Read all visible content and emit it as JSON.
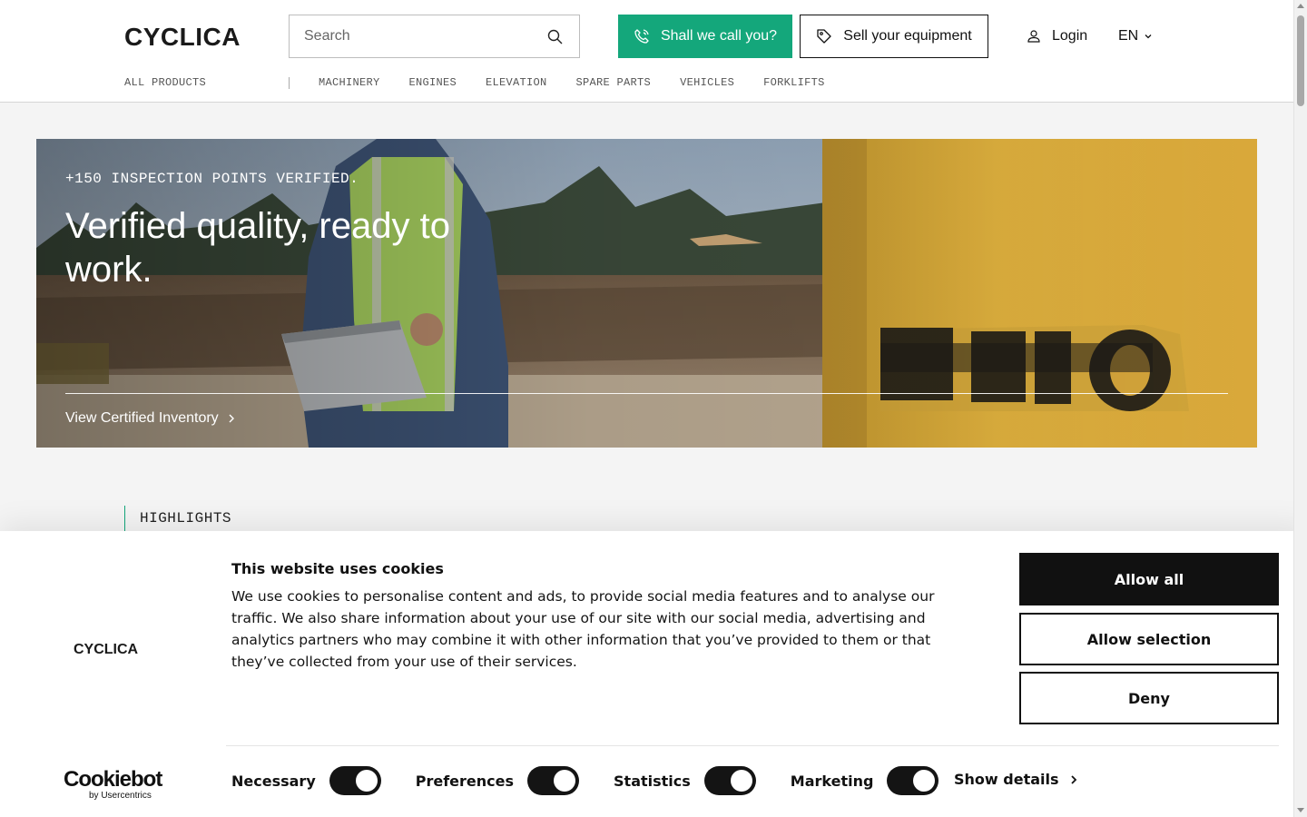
{
  "header": {
    "logo_text": "CYCLICA",
    "search_placeholder": "Search",
    "call_button": "Shall we call you?",
    "sell_button": "Sell your equipment",
    "login": "Login",
    "language": "EN",
    "accent": "#14a77b"
  },
  "nav": {
    "all_products": "ALL PRODUCTS",
    "items": [
      "MACHINERY",
      "ENGINES",
      "ELEVATION",
      "SPARE PARTS",
      "VEHICLES",
      "FORKLIFTS"
    ]
  },
  "hero": {
    "eyebrow": "+150 INSPECTION POINTS VERIFIED.",
    "title": "Verified quality, ready to work.",
    "link": "View Certified Inventory"
  },
  "highlights": {
    "label": "HIGHLIGHTS"
  },
  "cookie": {
    "logo_text": "CYCLICA",
    "title": "This website uses cookies",
    "text": "We use cookies to personalise content and ads, to provide social media features and to analyse our traffic. We also share information about your use of our site with our social media, advertising and analytics partners who may combine it with other information that you’ve provided to them or that they’ve collected from your use of their services.",
    "allow_all": "Allow all",
    "allow_selection": "Allow selection",
    "deny": "Deny",
    "toggles": [
      "Necessary",
      "Preferences",
      "Statistics",
      "Marketing"
    ],
    "show_details": "Show details",
    "brand": "Cookiebot",
    "brand_sub": "by Usercentrics"
  }
}
